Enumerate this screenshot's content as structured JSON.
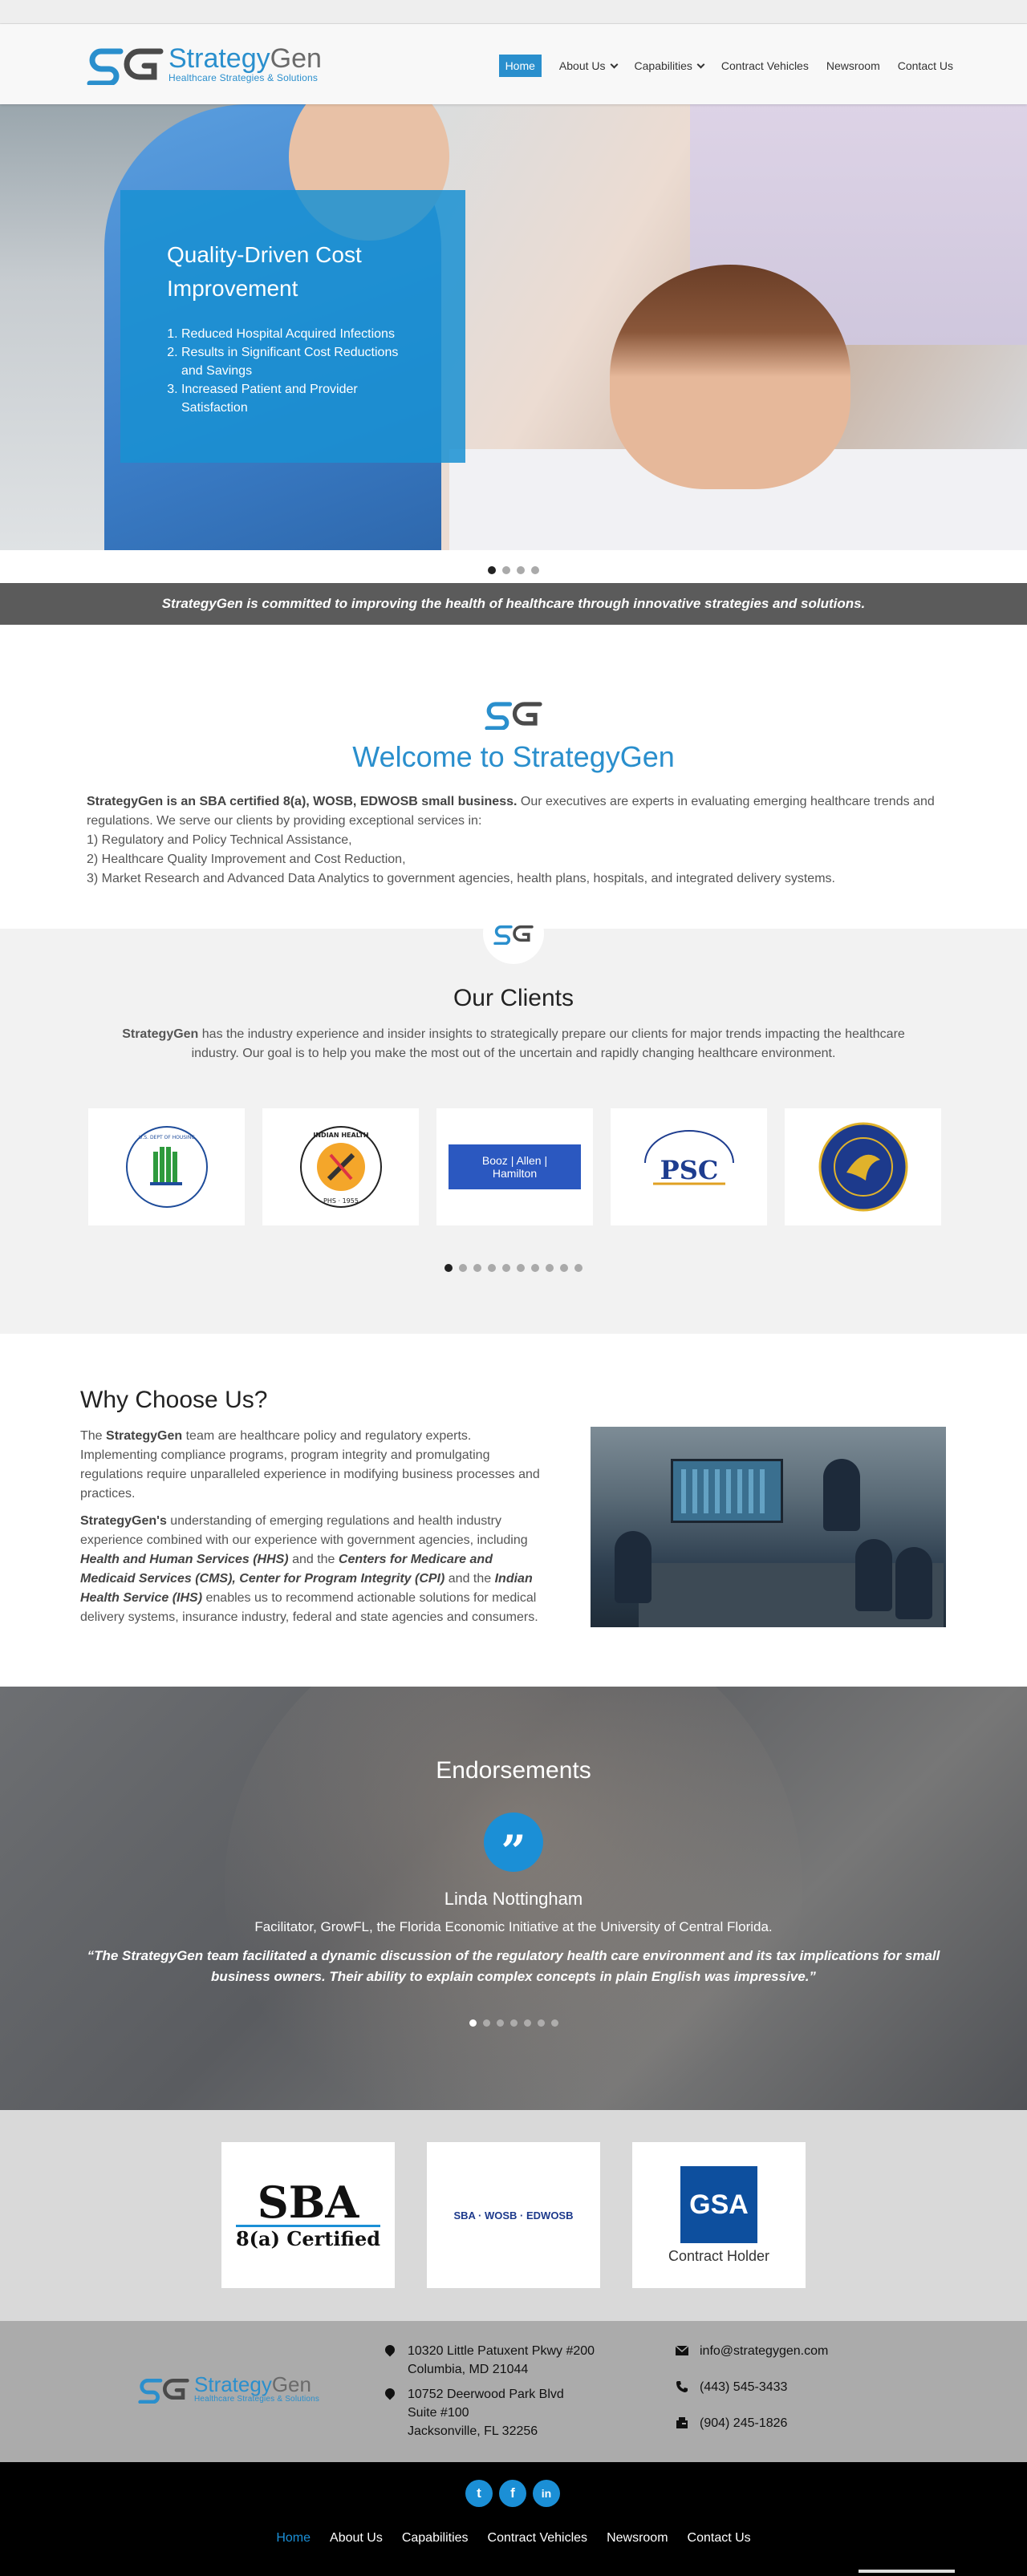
{
  "brand": {
    "name_a": "Strategy",
    "name_b": "Gen",
    "tagline": "Healthcare Strategies & Solutions"
  },
  "nav": {
    "items": [
      {
        "label": "Home",
        "active": true,
        "dropdown": false
      },
      {
        "label": "About Us",
        "active": false,
        "dropdown": true
      },
      {
        "label": "Capabilities",
        "active": false,
        "dropdown": true
      },
      {
        "label": "Contract Vehicles",
        "active": false,
        "dropdown": false
      },
      {
        "label": "Newsroom",
        "active": false,
        "dropdown": false
      },
      {
        "label": "Contact Us",
        "active": false,
        "dropdown": false
      }
    ]
  },
  "hero": {
    "title": "Quality-Driven Cost Improvement",
    "list": [
      "Reduced Hospital Acquired Infections",
      "Results in Significant Cost Reductions and Savings",
      "Increased Patient and Provider Satisfaction"
    ],
    "slide_count": 4,
    "active_slide": 1
  },
  "tagline": "StrategyGen is committed to improving the health of healthcare through innovative strategies and solutions.",
  "welcome": {
    "title": "Welcome to StrategyGen",
    "lead_bold": "StrategyGen is an SBA certified 8(a), WOSB, EDWOSB small business.",
    "lead_rest": " Our executives are experts in evaluating emerging healthcare trends and regulations. We serve our clients by providing exceptional services in:",
    "services": [
      "1) Regulatory and Policy Technical Assistance,",
      "2) Healthcare Quality Improvement and Cost Reduction,",
      "3) Market Research and Advanced Data Analytics to government agencies, health plans, hospitals, and integrated delivery systems."
    ]
  },
  "clients": {
    "title": "Our Clients",
    "text_bold": "StrategyGen",
    "text_rest": " has the industry experience and insider insights to strategically prepare our clients for major trends impacting the healthcare industry. Our goal is to help you make the most out of the uncertain and rapidly changing healthcare environment.",
    "logos": [
      {
        "name": "hud-seal",
        "label": "U.S. DEPARTMENT OF HOUSING AND URBAN DEVELOPMENT"
      },
      {
        "name": "ihs-seal",
        "label": "INDIAN HEALTH SERVICE · PHS · 1955"
      },
      {
        "name": "booz-allen-logo",
        "label": "Booz | Allen | Hamilton"
      },
      {
        "name": "psc-logo",
        "label": "PROGRAM SUPPORT CENTER",
        "abbr": "PSC"
      },
      {
        "name": "hhs-seal",
        "label": "DEPARTMENT OF HEALTH & HUMAN SERVICES USA"
      }
    ],
    "slide_count": 10,
    "active_slide": 1
  },
  "why": {
    "title": "Why Choose Us?",
    "p1_a": "The ",
    "p1_bold": "StrategyGen",
    "p1_b": " team are healthcare policy and regulatory experts. Implementing compliance programs, program integrity and promulgating regulations require unparalleled experience in modifying business processes and practices.",
    "p2_bold": "StrategyGen's",
    "p2_a": " understanding of emerging regulations and health industry experience combined with our experience with government agencies, including ",
    "p2_hhs": "Health and Human Services (HHS)",
    "p2_b": " and the ",
    "p2_cms": "Centers for Medicare and Medicaid Services (CMS)",
    "p2_c": ", ",
    "p2_cpi": "Center for Program Integrity (CPI)",
    "p2_d": " and the ",
    "p2_ihs": "Indian Health Service (IHS)",
    "p2_e": " enables us to recommend actionable solutions for medical delivery systems, insurance industry, federal and state agencies and consumers."
  },
  "endorsements": {
    "title": "Endorsements",
    "name": "Linda Nottingham",
    "role": "Facilitator, GrowFL, the Florida Economic Initiative at the University of Central Florida.",
    "quote": "“The StrategyGen team facilitated a dynamic discussion of the regulatory health care environment and its tax implications for small business owners. Their ability to explain complex concepts in plain English was impressive.”",
    "slide_count": 7,
    "active_slide": 1
  },
  "certifications": {
    "sba_top": "SBA",
    "sba_bottom": "8(a) Certified",
    "wosb_label": "SBA · WOSB · EDWOSB",
    "gsa_mark": "GSA",
    "gsa_caption": "Contract Holder"
  },
  "footer": {
    "address1": [
      "10320 Little Patuxent Pkwy #200",
      "Columbia, MD 21044"
    ],
    "address2": [
      "10752 Deerwood Park Blvd",
      "Suite #100",
      "Jacksonville, FL 32256"
    ],
    "email": "info@strategygen.com",
    "phone": "(443) 545-3433",
    "fax": "(904) 245-1826"
  },
  "social": [
    {
      "name": "twitter",
      "glyph": "t"
    },
    {
      "name": "facebook",
      "glyph": "f"
    },
    {
      "name": "linkedin",
      "glyph": "in"
    }
  ],
  "bottom_nav": [
    {
      "label": "Home",
      "active": true
    },
    {
      "label": "About Us",
      "active": false
    },
    {
      "label": "Capabilities",
      "active": false
    },
    {
      "label": "Contract Vehicles",
      "active": false
    },
    {
      "label": "Newsroom",
      "active": false
    },
    {
      "label": "Contact Us",
      "active": false
    }
  ],
  "colors": {
    "accent": "#2a8fcd",
    "social": "#1b8fd6",
    "tagline_bar": "#5b5b5b",
    "footer": "#ababab"
  }
}
